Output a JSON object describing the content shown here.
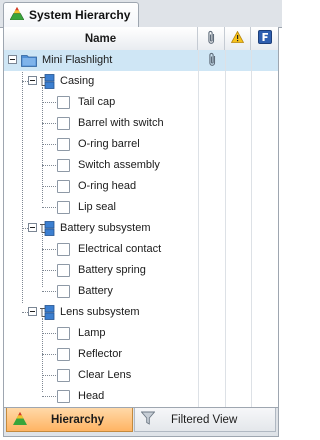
{
  "window": {
    "title": "System Hierarchy"
  },
  "columns": {
    "name": "Name",
    "attachment_icon": "paperclip-icon",
    "warning_icon": "warning-icon",
    "flag_icon": "f-icon"
  },
  "tree": {
    "root": "Mini Flashlight",
    "casing": {
      "label": "Casing",
      "children": [
        "Tail cap",
        "Barrel with switch",
        "O-ring barrel",
        "Switch assembly",
        "O-ring head",
        "Lip seal"
      ]
    },
    "battery": {
      "label": "Battery subsystem",
      "children": [
        "Electrical contact",
        "Battery spring",
        "Battery"
      ]
    },
    "lens": {
      "label": "Lens subsystem",
      "children": [
        "Lamp",
        "Reflector",
        "Clear Lens",
        "Head"
      ]
    }
  },
  "bottom_tabs": {
    "hierarchy": "Hierarchy",
    "filtered": "Filtered View"
  },
  "colors": {
    "selected_row": "#cfe6f5",
    "active_tab": "#ffb463",
    "flag_blue": "#2f5fb0"
  }
}
